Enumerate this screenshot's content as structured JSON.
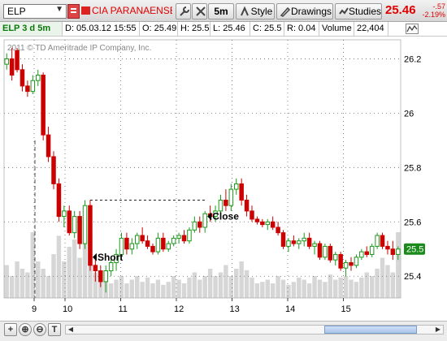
{
  "toolbar": {
    "symbol": "ELP",
    "company": "CIA PARANAENSE ...",
    "interval": "5m",
    "style_label": "Style",
    "drawings_label": "Drawings",
    "studies_label": "Studies",
    "last_price": "25.46",
    "change": "-.57",
    "change_pct": "-2.19%"
  },
  "info": {
    "title": "ELP 3 d 5m",
    "date": "D: 05.03.12 15:55",
    "open": "O: 25.49",
    "high": "H: 25.5",
    "low": "L: 25.46",
    "close": "C: 25.5",
    "range": "R: 0.04",
    "volume_label": "Volume",
    "volume": "22,404"
  },
  "colors": {
    "up": "#1a9a1a",
    "down": "#cc0000",
    "volume": "#d6d6d6",
    "grid": "#666666",
    "price_badge": "#1a8a1a"
  },
  "watermark": "2011 © TD Ameritrade IP Company, Inc.",
  "chart_data": {
    "type": "candlestick",
    "ylim": [
      25.32,
      26.27
    ],
    "y_ticks": [
      "26.2",
      "26",
      "25.8",
      "25.6",
      "25.4"
    ],
    "x_ticks": [
      "9",
      "10",
      "11",
      "12",
      "13",
      "14",
      "15"
    ],
    "current_price_label": "25.5",
    "annotations": [
      {
        "text": "Short",
        "price": 25.47
      },
      {
        "text": "Close",
        "price": 25.62
      }
    ],
    "candles": [
      [
        26.18,
        26.22,
        26.16,
        26.2
      ],
      [
        26.2,
        26.24,
        26.12,
        26.14
      ],
      [
        26.23,
        26.24,
        26.15,
        26.16
      ],
      [
        26.16,
        26.18,
        26.08,
        26.1
      ],
      [
        26.1,
        26.12,
        26.06,
        26.08
      ],
      [
        26.08,
        26.14,
        26.07,
        26.12
      ],
      [
        26.12,
        26.16,
        26.1,
        26.14
      ],
      [
        26.14,
        26.15,
        25.9,
        25.92
      ],
      [
        25.92,
        25.95,
        25.82,
        25.84
      ],
      [
        25.84,
        25.86,
        25.72,
        25.74
      ],
      [
        25.74,
        25.76,
        25.6,
        25.62
      ],
      [
        25.62,
        25.66,
        25.58,
        25.64
      ],
      [
        25.64,
        25.66,
        25.55,
        25.56
      ],
      [
        25.56,
        25.64,
        25.54,
        25.62
      ],
      [
        25.62,
        25.64,
        25.5,
        25.52
      ],
      [
        25.52,
        25.68,
        25.5,
        25.66
      ],
      [
        25.66,
        25.68,
        25.42,
        25.44
      ],
      [
        25.44,
        25.48,
        25.38,
        25.42
      ],
      [
        25.42,
        25.44,
        25.36,
        25.38
      ],
      [
        25.38,
        25.44,
        25.34,
        25.42
      ],
      [
        25.42,
        25.46,
        25.4,
        25.45
      ],
      [
        25.45,
        25.5,
        25.42,
        25.48
      ],
      [
        25.48,
        25.56,
        25.46,
        25.54
      ],
      [
        25.54,
        25.56,
        25.48,
        25.5
      ],
      [
        25.5,
        25.54,
        25.48,
        25.52
      ],
      [
        25.52,
        25.56,
        25.5,
        25.55
      ],
      [
        25.55,
        25.58,
        25.52,
        25.53
      ],
      [
        25.53,
        25.55,
        25.5,
        25.51
      ],
      [
        25.51,
        25.52,
        25.48,
        25.49
      ],
      [
        25.49,
        25.56,
        25.48,
        25.54
      ],
      [
        25.54,
        25.56,
        25.49,
        25.5
      ],
      [
        25.5,
        25.53,
        25.49,
        25.52
      ],
      [
        25.52,
        25.55,
        25.51,
        25.54
      ],
      [
        25.54,
        25.56,
        25.52,
        25.55
      ],
      [
        25.55,
        25.57,
        25.52,
        25.53
      ],
      [
        25.53,
        25.58,
        25.52,
        25.57
      ],
      [
        25.57,
        25.62,
        25.56,
        25.6
      ],
      [
        25.6,
        25.62,
        25.56,
        25.58
      ],
      [
        25.58,
        25.64,
        25.56,
        25.63
      ],
      [
        25.63,
        25.66,
        25.6,
        25.62
      ],
      [
        25.62,
        25.66,
        25.6,
        25.64
      ],
      [
        25.64,
        25.7,
        25.62,
        25.68
      ],
      [
        25.68,
        25.72,
        25.64,
        25.66
      ],
      [
        25.66,
        25.74,
        25.64,
        25.72
      ],
      [
        25.72,
        25.76,
        25.7,
        25.74
      ],
      [
        25.74,
        25.76,
        25.66,
        25.68
      ],
      [
        25.68,
        25.7,
        25.62,
        25.64
      ],
      [
        25.64,
        25.66,
        25.6,
        25.61
      ],
      [
        25.61,
        25.62,
        25.59,
        25.6
      ],
      [
        25.6,
        25.61,
        25.58,
        25.59
      ],
      [
        25.59,
        25.61,
        25.57,
        25.6
      ],
      [
        25.6,
        25.62,
        25.57,
        25.58
      ],
      [
        25.58,
        25.6,
        25.55,
        25.56
      ],
      [
        25.56,
        25.57,
        25.5,
        25.51
      ],
      [
        25.51,
        25.54,
        25.49,
        25.53
      ],
      [
        25.53,
        25.55,
        25.51,
        25.52
      ],
      [
        25.52,
        25.54,
        25.5,
        25.53
      ],
      [
        25.53,
        25.56,
        25.51,
        25.54
      ],
      [
        25.54,
        25.56,
        25.5,
        25.51
      ],
      [
        25.51,
        25.53,
        25.48,
        25.52
      ],
      [
        25.52,
        25.53,
        25.46,
        25.47
      ],
      [
        25.47,
        25.52,
        25.46,
        25.51
      ],
      [
        25.51,
        25.52,
        25.45,
        25.46
      ],
      [
        25.46,
        25.49,
        25.44,
        25.48
      ],
      [
        25.48,
        25.49,
        25.42,
        25.43
      ],
      [
        25.43,
        25.46,
        25.4,
        25.45
      ],
      [
        25.45,
        25.47,
        25.42,
        25.44
      ],
      [
        25.44,
        25.48,
        25.43,
        25.47
      ],
      [
        25.47,
        25.5,
        25.46,
        25.49
      ],
      [
        25.49,
        25.51,
        25.47,
        25.48
      ],
      [
        25.48,
        25.52,
        25.47,
        25.51
      ],
      [
        25.51,
        25.56,
        25.5,
        25.55
      ],
      [
        25.55,
        25.56,
        25.5,
        25.51
      ],
      [
        25.51,
        25.53,
        25.48,
        25.5
      ],
      [
        25.5,
        25.53,
        25.46,
        25.48
      ],
      [
        25.48,
        25.51,
        25.46,
        25.5
      ]
    ],
    "volumes": [
      0.45,
      0.3,
      0.5,
      0.4,
      0.35,
      0.9,
      0.5,
      0.4,
      0.3,
      0.6,
      0.85,
      0.5,
      0.7,
      0.8,
      0.55,
      0.75,
      0.9,
      0.35,
      0.25,
      0.3,
      0.2,
      0.25,
      0.3,
      0.2,
      0.25,
      0.3,
      0.22,
      0.28,
      0.2,
      0.25,
      0.18,
      0.22,
      0.3,
      0.25,
      0.2,
      0.28,
      0.35,
      0.25,
      0.3,
      0.4,
      0.3,
      0.35,
      0.45,
      0.3,
      0.4,
      0.5,
      0.38,
      0.28,
      0.2,
      0.22,
      0.25,
      0.2,
      0.3,
      0.25,
      0.18,
      0.22,
      0.28,
      0.25,
      0.2,
      0.3,
      0.25,
      0.22,
      0.32,
      0.25,
      0.28,
      0.3,
      0.25,
      0.22,
      0.28,
      0.35,
      0.3,
      0.4,
      0.55,
      0.45,
      0.35,
      0.9
    ]
  },
  "bottom": {
    "zoom_in": "+",
    "zoom_out": "−",
    "trend": "T"
  }
}
